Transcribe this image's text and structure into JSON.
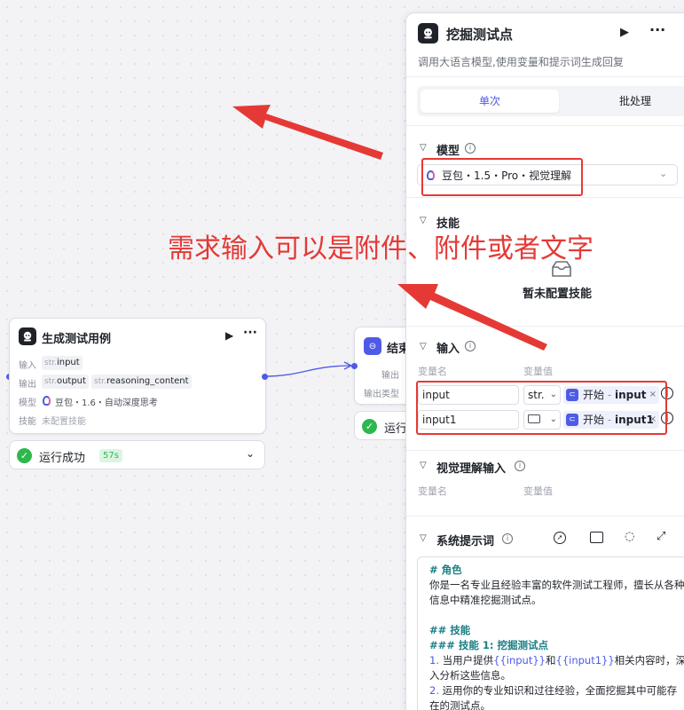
{
  "canvas": {
    "node_gen": {
      "title": "生成测试用例",
      "input_label": "输入",
      "output_label": "输出",
      "model_label": "模型",
      "skill_label": "技能",
      "input_chip_type": "str.",
      "input_chip_name": "input",
      "output_chip1_type": "str.",
      "output_chip1_name": "output",
      "output_chip2_type": "str.",
      "output_chip2_name": "reasoning_content",
      "model_value": "豆包・1.6・自动深度思考",
      "skill_value": "未配置技能",
      "status": "运行成功",
      "duration": "57s"
    },
    "node_end": {
      "title": "结束",
      "output_label": "输出",
      "output_type_label": "输出类型",
      "status": "运行"
    }
  },
  "panel": {
    "title": "挖掘测试点",
    "description": "调用大语言模型,使用变量和提示词生成回复",
    "tabs": [
      "单次",
      "批处理"
    ],
    "model_section": {
      "title": "模型",
      "selected": "豆包・1.5・Pro・视觉理解"
    },
    "skills_section": {
      "title": "技能",
      "empty_text": "暂未配置技能"
    },
    "input_section": {
      "title": "输入",
      "col_name": "变量名",
      "col_value": "变量值",
      "rows": [
        {
          "name": "input",
          "type": "str.",
          "ref_source": "开始",
          "ref_var": "input"
        },
        {
          "name": "input1",
          "type": "",
          "ref_source": "开始",
          "ref_var": "input1"
        }
      ]
    },
    "vision_section": {
      "title": "视觉理解输入",
      "col_name": "变量名",
      "col_value": "变量值"
    },
    "system_prompt": {
      "title": "系统提示词",
      "role_heading": "# 角色",
      "role_text": "你是一名专业且经验丰富的软件测试工程师，擅长从各种信息中精准挖掘测试点。",
      "skills_heading": "## 技能",
      "skill1_heading": "### 技能 1: 挖掘测试点",
      "item1_num": "1.",
      "item1_pre": "当用户提供",
      "item1_var1": "{{input}}",
      "item1_and": "和",
      "item1_var2": "{{input1}}",
      "item1_post": "相关内容时，深入分析这些信息。",
      "item2_num": "2.",
      "item2_text": "运用你的专业知识和过往经验，全面挖掘其中可能存在的测试点。"
    }
  },
  "annotation": {
    "text": "需求输入可以是附件、附件或者文字",
    "color": "#e53935"
  }
}
